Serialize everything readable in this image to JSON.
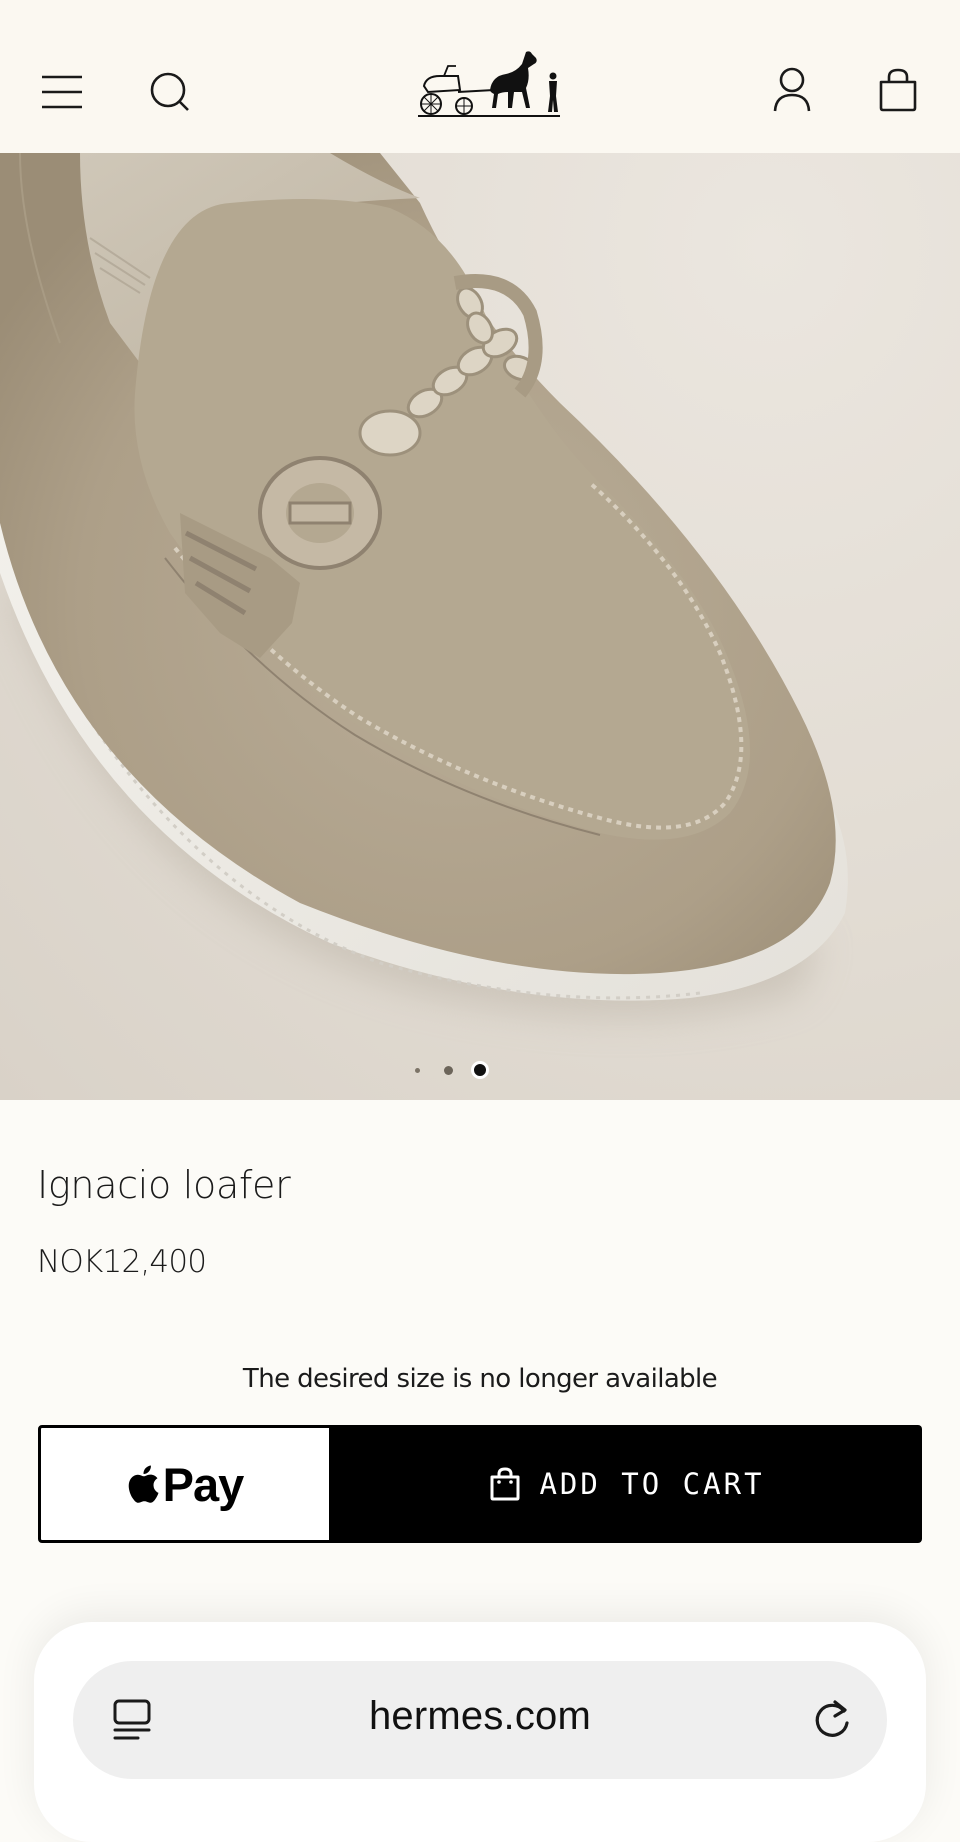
{
  "header": {
    "icons": {
      "menu": "hamburger-menu-icon",
      "search": "search-icon",
      "logo": "hermes-carriage-logo",
      "account": "account-icon",
      "bag": "shopping-bag-icon"
    }
  },
  "gallery": {
    "slide_count": 3,
    "active_slide": 3
  },
  "product": {
    "name": "Ignacio loafer",
    "price": "NOK12,400",
    "availability_message": "The desired size is no longer available"
  },
  "actions": {
    "apple_pay_label": "Pay",
    "add_to_cart_label": "ADD TO CART"
  },
  "browser": {
    "url": "hermes.com",
    "icons": {
      "tabs": "tabs-icon",
      "reload": "reload-icon"
    }
  },
  "colors": {
    "header_bg": "#fbf8f1",
    "page_bg": "#fcfbf7",
    "cart_button_bg": "#000000",
    "suede": "#b3a690",
    "sole": "#f3f1ec"
  }
}
